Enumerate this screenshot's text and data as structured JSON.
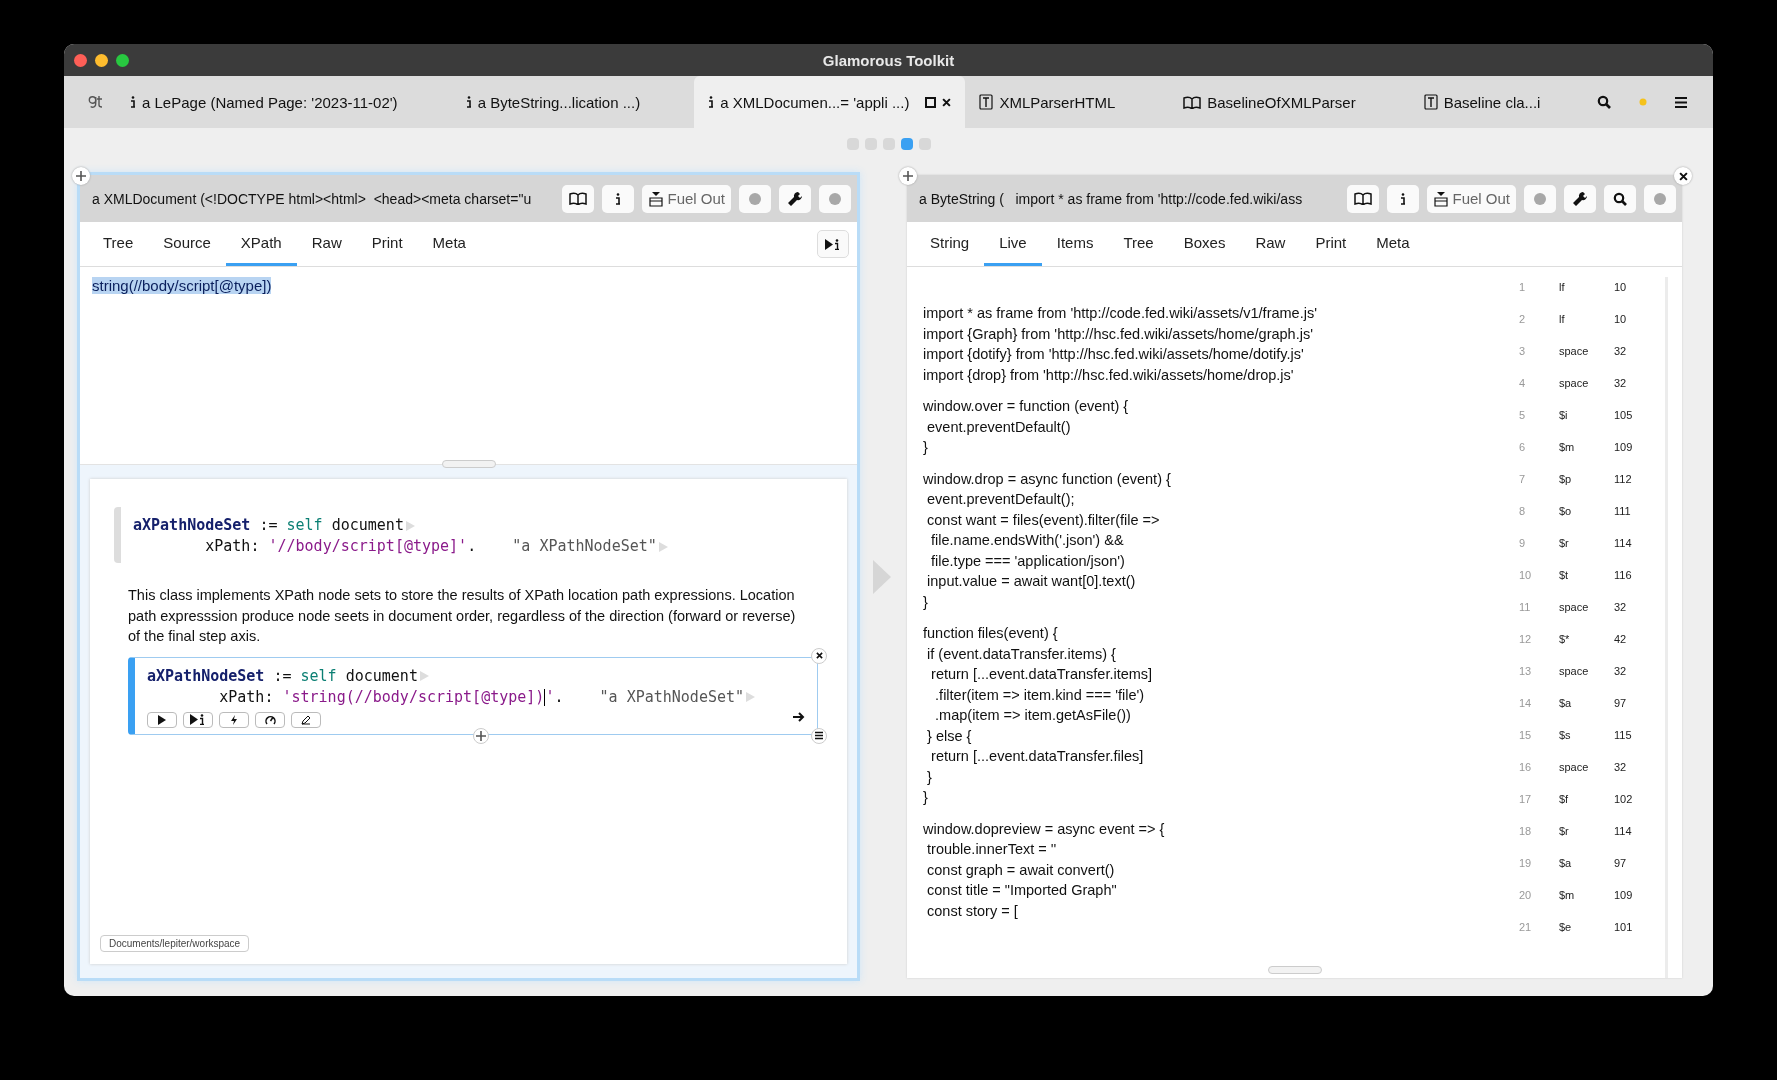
{
  "window": {
    "title": "Glamorous Toolkit"
  },
  "tabs": [
    {
      "label": "a LePage (Named Page: '2023-11-02')",
      "kind": "object",
      "selected": false
    },
    {
      "label": "a ByteString...lication ...)",
      "kind": "object",
      "selected": false
    },
    {
      "label": "a XMLDocumen...= 'appli ...)",
      "kind": "object",
      "selected": true
    },
    {
      "label": "XMLParserHTML",
      "kind": "class",
      "selected": false
    },
    {
      "label": "BaselineOfXMLParser",
      "kind": "package",
      "selected": false
    },
    {
      "label": "Baseline cla...i",
      "kind": "class",
      "selected": false
    }
  ],
  "page_dots": [
    {
      "selected": false
    },
    {
      "selected": false
    },
    {
      "selected": false
    },
    {
      "selected": true
    },
    {
      "selected": false
    }
  ],
  "left_pane": {
    "header": "a XMLDocument (<!DOCTYPE html><html>  <head><meta charset=\"u",
    "fuel_button": "Fuel Out",
    "tabs": [
      {
        "label": "Tree",
        "selected": false
      },
      {
        "label": "Source",
        "selected": false
      },
      {
        "label": "XPath",
        "selected": true
      },
      {
        "label": "Raw",
        "selected": false
      },
      {
        "label": "Print",
        "selected": false
      },
      {
        "label": "Meta",
        "selected": false
      }
    ],
    "query": {
      "text": "string(//body/script[@type])",
      "selected": true
    },
    "snippets": [
      {
        "kind": "code",
        "focused": false,
        "lines": [
          [
            {
              "kind": "variable",
              "text": "aXPathNodeSet"
            },
            {
              "kind": "plain",
              "text": " := "
            },
            {
              "kind": "keyword",
              "text": "self"
            },
            {
              "kind": "plain",
              "text": " document"
            }
          ],
          [
            {
              "kind": "plain",
              "text": "        xPath: "
            },
            {
              "kind": "string",
              "text": "'//body/script[@type]'"
            },
            {
              "kind": "plain",
              "text": ".    "
            },
            {
              "kind": "comment",
              "text": "\"a XPathNodeSet\""
            }
          ]
        ]
      },
      {
        "kind": "text",
        "text": "This class implements XPath node sets to store the results of XPath location path expressions. Location path expresssion produce node seets in document order, regardless of the direction (forward or reverse) of the final step axis."
      },
      {
        "kind": "code",
        "focused": true,
        "lines": [
          [
            {
              "kind": "variable",
              "text": "aXPathNodeSet"
            },
            {
              "kind": "plain",
              "text": " := "
            },
            {
              "kind": "keyword",
              "text": "self"
            },
            {
              "kind": "plain",
              "text": " document"
            }
          ],
          [
            {
              "kind": "plain",
              "text": "        xPath: "
            },
            {
              "kind": "string",
              "text": "'string(//body/script[@type])"
            },
            {
              "kind": "cursor"
            },
            {
              "kind": "string",
              "text": "'"
            },
            {
              "kind": "plain",
              "text": ".    "
            },
            {
              "kind": "comment",
              "text": "\"a XPathNodeSet\""
            }
          ]
        ]
      }
    ],
    "path": "Documents/lepiter/workspace"
  },
  "right_pane": {
    "header": "a ByteString (   import * as frame from 'http://code.fed.wiki/ass",
    "fuel_button": "Fuel Out",
    "tabs": [
      {
        "label": "String",
        "selected": false
      },
      {
        "label": "Live",
        "selected": true
      },
      {
        "label": "Items",
        "selected": false
      },
      {
        "label": "Tree",
        "selected": false
      },
      {
        "label": "Boxes",
        "selected": false
      },
      {
        "label": "Raw",
        "selected": false
      },
      {
        "label": "Print",
        "selected": false
      },
      {
        "label": "Meta",
        "selected": false
      }
    ],
    "code_blocks": [
      [
        "import * as frame from 'http://code.fed.wiki/assets/v1/frame.js'",
        "import {Graph} from 'http://hsc.fed.wiki/assets/home/graph.js'",
        "import {dotify} from 'http://hsc.fed.wiki/assets/home/dotify.js'",
        "import {drop} from 'http://hsc.fed.wiki/assets/home/drop.js'"
      ],
      [
        "window.over = function (event) {",
        " event.preventDefault()",
        "}"
      ],
      [
        "window.drop = async function (event) {",
        " event.preventDefault();",
        " const want = files(event).filter(file =>",
        "  file.name.endsWith('.json') &&",
        "  file.type === 'application/json')",
        " input.value = await want[0].text()",
        "}"
      ],
      [
        "function files(event) {",
        " if (event.dataTransfer.items) {",
        "  return [...event.dataTransfer.items]",
        "   .filter(item => item.kind === 'file')",
        "   .map(item => item.getAsFile())",
        " } else {",
        "  return [...event.dataTransfer.files]",
        " }",
        "}"
      ],
      [
        "window.dopreview = async event => {",
        " trouble.innerText = ''",
        " const graph = await convert()",
        " const title = \"Imported Graph\"",
        " const story = ["
      ]
    ],
    "items": [
      {
        "index": "1",
        "char": "lf",
        "code": "10"
      },
      {
        "index": "2",
        "char": "lf",
        "code": "10"
      },
      {
        "index": "3",
        "char": "space",
        "code": "32"
      },
      {
        "index": "4",
        "char": "space",
        "code": "32"
      },
      {
        "index": "5",
        "char": "$i",
        "code": "105"
      },
      {
        "index": "6",
        "char": "$m",
        "code": "109"
      },
      {
        "index": "7",
        "char": "$p",
        "code": "112"
      },
      {
        "index": "8",
        "char": "$o",
        "code": "111"
      },
      {
        "index": "9",
        "char": "$r",
        "code": "114"
      },
      {
        "index": "10",
        "char": "$t",
        "code": "116"
      },
      {
        "index": "11",
        "char": "space",
        "code": "32"
      },
      {
        "index": "12",
        "char": "$*",
        "code": "42"
      },
      {
        "index": "13",
        "char": "space",
        "code": "32"
      },
      {
        "index": "14",
        "char": "$a",
        "code": "97"
      },
      {
        "index": "15",
        "char": "$s",
        "code": "115"
      },
      {
        "index": "16",
        "char": "space",
        "code": "32"
      },
      {
        "index": "17",
        "char": "$f",
        "code": "102"
      },
      {
        "index": "18",
        "char": "$r",
        "code": "114"
      },
      {
        "index": "19",
        "char": "$a",
        "code": "97"
      },
      {
        "index": "20",
        "char": "$m",
        "code": "109"
      },
      {
        "index": "21",
        "char": "$e",
        "code": "101"
      }
    ]
  }
}
